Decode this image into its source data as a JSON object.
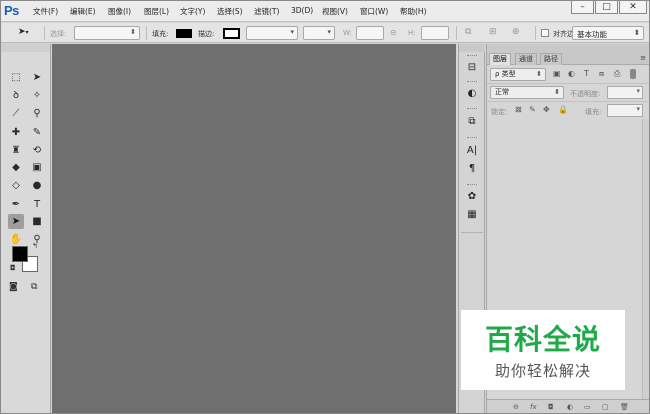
{
  "app": {
    "logo": "Ps",
    "menu": [
      "文件(F)",
      "编辑(E)",
      "图像(I)",
      "图层(L)",
      "文字(Y)",
      "选择(S)",
      "滤镜(T)",
      "3D(D)",
      "视图(V)",
      "窗口(W)",
      "帮助(H)"
    ],
    "window_buttons": {
      "minimize": "–",
      "maximize": "□",
      "close": "✕"
    }
  },
  "options_bar": {
    "select_label": "选择:",
    "fill_label": "填充:",
    "stroke_label": "描边:",
    "w_label": "W:",
    "h_label": "H:",
    "align_label": "对齐边缘",
    "workspace": "基本功能",
    "link_glyph": "⊝"
  },
  "toolbar": {
    "tools": [
      {
        "name": "marquee-tool-icon",
        "glyph": "⬚"
      },
      {
        "name": "move-tool-icon",
        "glyph": "➤"
      },
      {
        "name": "lasso-tool-icon",
        "glyph": "ꝺ"
      },
      {
        "name": "magic-wand-tool-icon",
        "glyph": "✧"
      },
      {
        "name": "crop-tool-icon",
        "glyph": "⟋"
      },
      {
        "name": "eyedropper-tool-icon",
        "glyph": "⚲"
      },
      {
        "name": "healing-brush-tool-icon",
        "glyph": "✚"
      },
      {
        "name": "brush-tool-icon",
        "glyph": "✎"
      },
      {
        "name": "clone-stamp-tool-icon",
        "glyph": "♜"
      },
      {
        "name": "history-brush-tool-icon",
        "glyph": "⟲"
      },
      {
        "name": "eraser-tool-icon",
        "glyph": "◆"
      },
      {
        "name": "gradient-tool-icon",
        "glyph": "▣"
      },
      {
        "name": "blur-tool-icon",
        "glyph": "◇"
      },
      {
        "name": "dodge-tool-icon",
        "glyph": "●"
      },
      {
        "name": "pen-tool-icon",
        "glyph": "✒"
      },
      {
        "name": "type-tool-icon",
        "glyph": "T"
      },
      {
        "name": "path-selection-tool-icon",
        "glyph": "➤"
      },
      {
        "name": "shape-tool-icon",
        "glyph": "■"
      },
      {
        "name": "hand-tool-icon",
        "glyph": "✋"
      },
      {
        "name": "zoom-tool-icon",
        "glyph": "⚲"
      }
    ],
    "foreground_color": "#000000",
    "background_color": "#ffffff"
  },
  "dock": {
    "buttons": [
      {
        "name": "history-panel-icon",
        "glyph": "⊟"
      },
      {
        "name": "adjustments-panel-icon",
        "glyph": "◐"
      },
      {
        "name": "properties-panel-icon",
        "glyph": "⧉"
      },
      {
        "name": "character-panel-icon",
        "glyph": "A|"
      },
      {
        "name": "paragraph-panel-icon",
        "glyph": "¶"
      },
      {
        "name": "color-palette-panel-icon",
        "glyph": "✿"
      },
      {
        "name": "swatches-panel-icon",
        "glyph": "▦"
      }
    ]
  },
  "layers_panel": {
    "tabs": [
      "图层",
      "通道",
      "路径"
    ],
    "active_tab": 0,
    "menu_glyph": "≡",
    "filter_label": "ρ 类型",
    "blend_mode": "正常",
    "opacity_label": "不透明度:",
    "lock_label": "锁定:",
    "fill_label": "填充:",
    "footer_icons": [
      "⊖",
      "fx",
      "◘",
      "◐",
      "▭",
      "▢",
      "🗑"
    ]
  },
  "watermark": {
    "title": "百科全说",
    "subtitle": "助你轻松解决"
  }
}
